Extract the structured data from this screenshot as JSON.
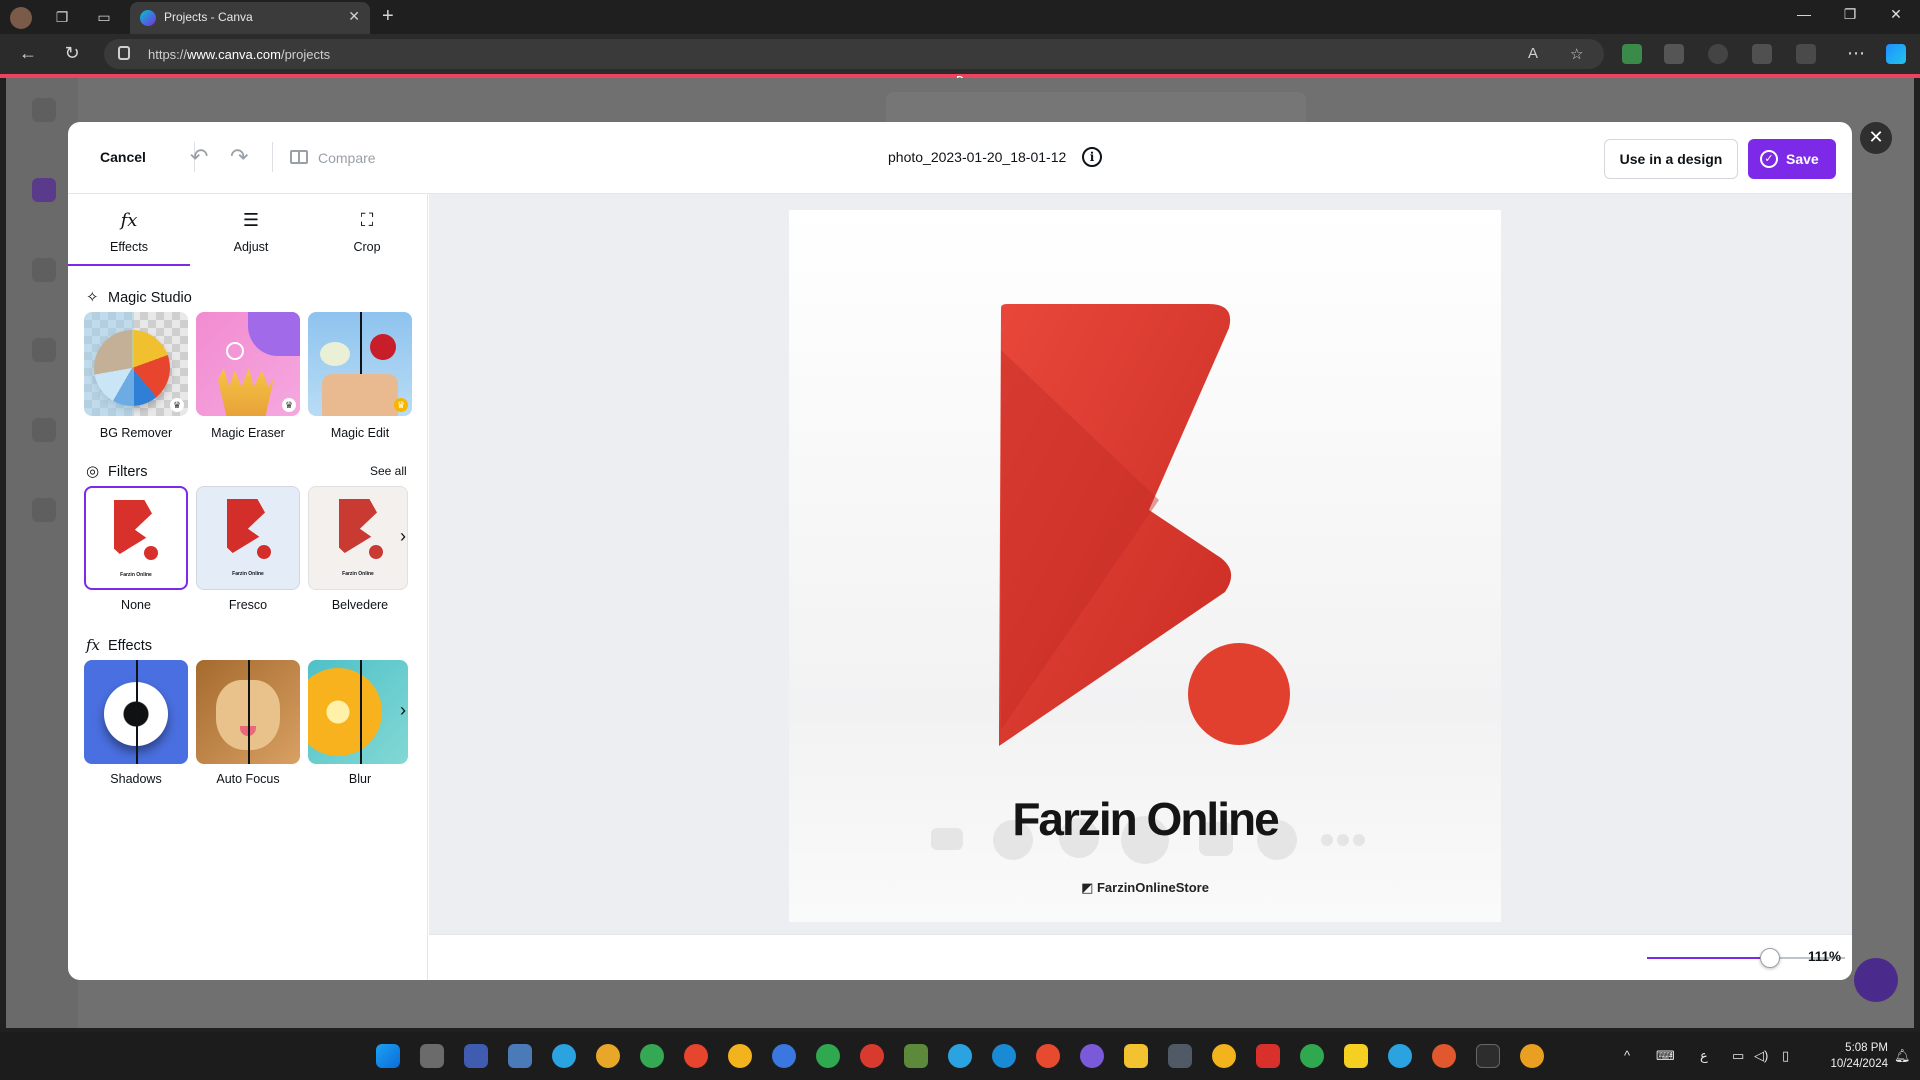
{
  "browser": {
    "tab_title": "Projects - Canva",
    "url_prefix": "https://",
    "url_domain": "www.canva.com",
    "url_path": "/projects",
    "accent_color": "#f0425f",
    "accent_badge": "D"
  },
  "editor": {
    "cancel_label": "Cancel",
    "compare_label": "Compare",
    "filename": "photo_2023-01-20_18-01-12",
    "use_in_design_label": "Use in a design",
    "save_label": "Save",
    "brand_color": "#7d2ae8",
    "close_label": "✕"
  },
  "panel": {
    "tabs": [
      {
        "label": "Effects",
        "icon": "fx",
        "active": true
      },
      {
        "label": "Adjust",
        "icon": "sliders-icon"
      },
      {
        "label": "Crop",
        "icon": "crop-icon"
      }
    ],
    "magic_studio": {
      "title": "Magic Studio",
      "items": [
        {
          "label": "BG Remover",
          "icon": "beach-ball"
        },
        {
          "label": "Magic Eraser",
          "icon": "fries"
        },
        {
          "label": "Magic Edit",
          "icon": "rose"
        }
      ]
    },
    "filters": {
      "title": "Filters",
      "see_all": "See all",
      "items": [
        {
          "label": "None",
          "selected": true
        },
        {
          "label": "Fresco"
        },
        {
          "label": "Belvedere"
        }
      ]
    },
    "effects": {
      "title": "Effects",
      "items": [
        {
          "label": "Shadows",
          "icon": "soccer-ball"
        },
        {
          "label": "Auto Focus",
          "icon": "dog"
        },
        {
          "label": "Blur",
          "icon": "orange"
        }
      ]
    }
  },
  "canvas": {
    "brand_name": "Farzin Online",
    "handle": "FarzinOnlineStore",
    "zoom_value": "111%",
    "zoom_fraction": 0.62,
    "logo_red": "#e03c2e"
  },
  "taskbar": {
    "time": "5:08 PM",
    "date": "10/24/2024",
    "lang": "ﻉ"
  }
}
